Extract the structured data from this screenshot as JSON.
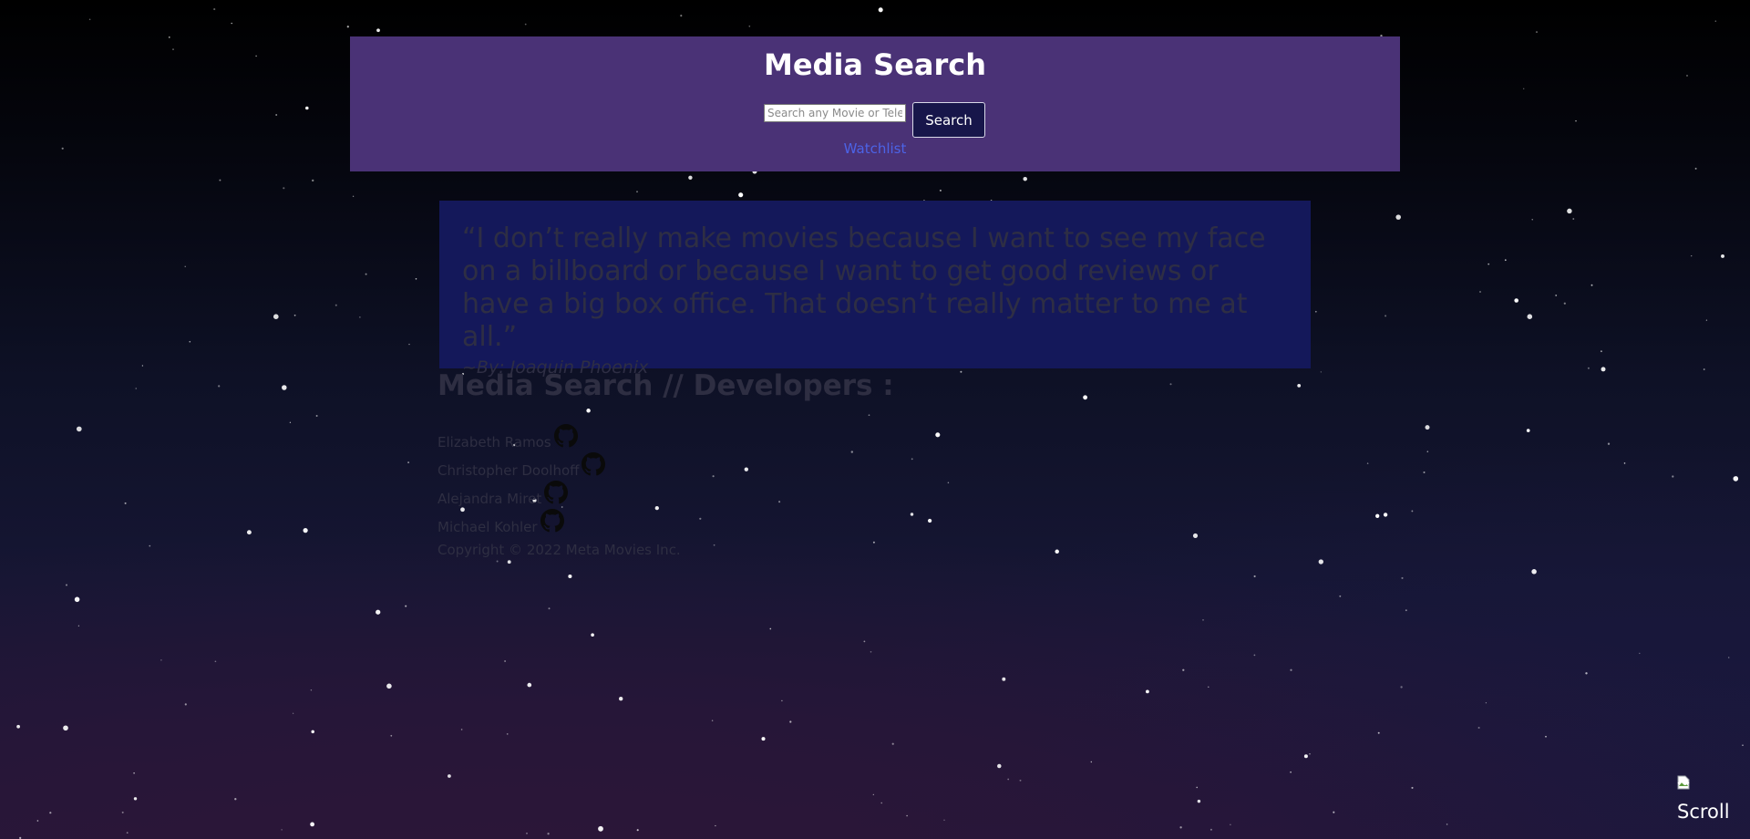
{
  "header": {
    "title": "Media Search",
    "search_placeholder": "Search any Movie or Television",
    "search_button": "Search",
    "watchlist_link": "Watchlist"
  },
  "quote": {
    "text": "“I don’t really make movies because I want to see my face on a billboard or because I want to get good reviews or have a big box office. That doesn’t really matter to me at all.”",
    "author": "~By: Joaquin Phoenix"
  },
  "developers": {
    "title": "Media Search // Developers :",
    "people": [
      {
        "name": "Elizabeth Ramos",
        "icon": "github-icon"
      },
      {
        "name": "Christopher Doolhoff",
        "icon": "github-icon"
      },
      {
        "name": "Alejandra Miret",
        "icon": "github-icon"
      },
      {
        "name": "Michael Kohler",
        "icon": "github-icon"
      }
    ]
  },
  "footer": {
    "copyright": "Copyright © 2022 Meta Movies Inc."
  },
  "scroll_button": {
    "label": "Scroll",
    "icon": "broken-image-icon"
  },
  "colors": {
    "header_bg": "#4a3276",
    "quote_bg": "#14185a",
    "link": "#4c63e6",
    "button_bg": "#17164a",
    "muted_text": "#2e2e42"
  }
}
